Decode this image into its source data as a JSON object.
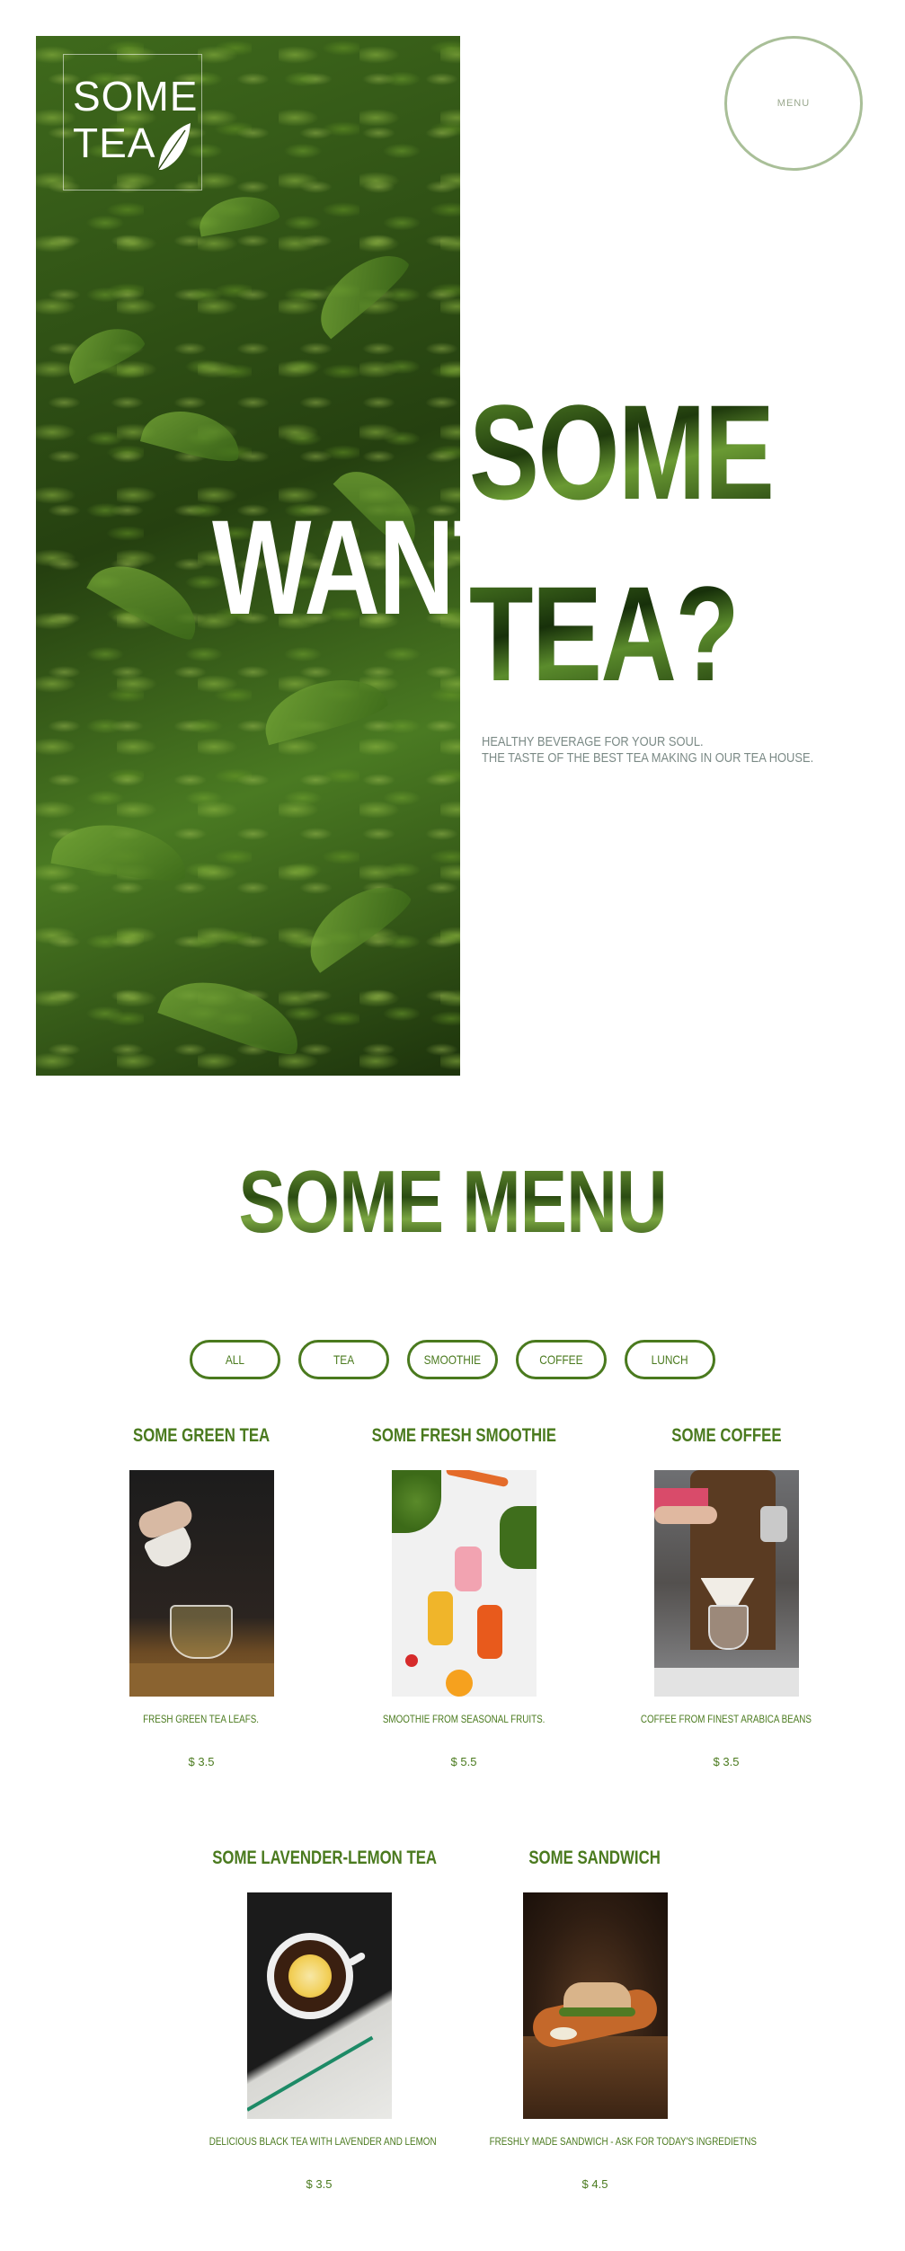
{
  "brand": {
    "logo_line1": "SOME",
    "logo_line2": "TEA"
  },
  "nav": {
    "menu_label": "MENU"
  },
  "hero": {
    "word_some": "SOME",
    "word_want": "WANT",
    "word_tea": "TEA?",
    "tagline_line1": "HEALTHY BEVERAGE FOR YOUR SOUL.",
    "tagline_line2": "THE TASTE OF THE BEST TEA MAKING IN OUR TEA HOUSE."
  },
  "menu_section": {
    "title": "SOME MENU",
    "filters": [
      {
        "label": "ALL"
      },
      {
        "label": "TEA"
      },
      {
        "label": "SMOOTHIE"
      },
      {
        "label": "COFFEE"
      },
      {
        "label": "LUNCH"
      }
    ],
    "items": [
      {
        "title": "SOME GREEN TEA",
        "description": "FRESH GREEN TEA LEAFS.",
        "price": "$ 3.5"
      },
      {
        "title": "SOME FRESH SMOOTHIE",
        "description": "SMOOTHIE FROM SEASONAL FRUITS.",
        "price": "$ 5.5"
      },
      {
        "title": "SOME COFFEE",
        "description": "COFFEE FROM FINEST ARABICA BEANS",
        "price": "$ 3.5"
      },
      {
        "title": "SOME LAVENDER-LEMON TEA",
        "description": "DELICIOUS BLACK TEA WITH LAVENDER AND LEMON",
        "price": "$ 3.5"
      },
      {
        "title": "SOME SANDWICH",
        "description": "FRESHLY MADE SANDWICH - ASK FOR TODAY'S INGREDIETNS",
        "price": "$ 4.5"
      }
    ]
  },
  "colors": {
    "accent_green": "#4a7a1e",
    "menu_ring": "#a9bf98",
    "tagline_gray": "#7b8a86"
  }
}
